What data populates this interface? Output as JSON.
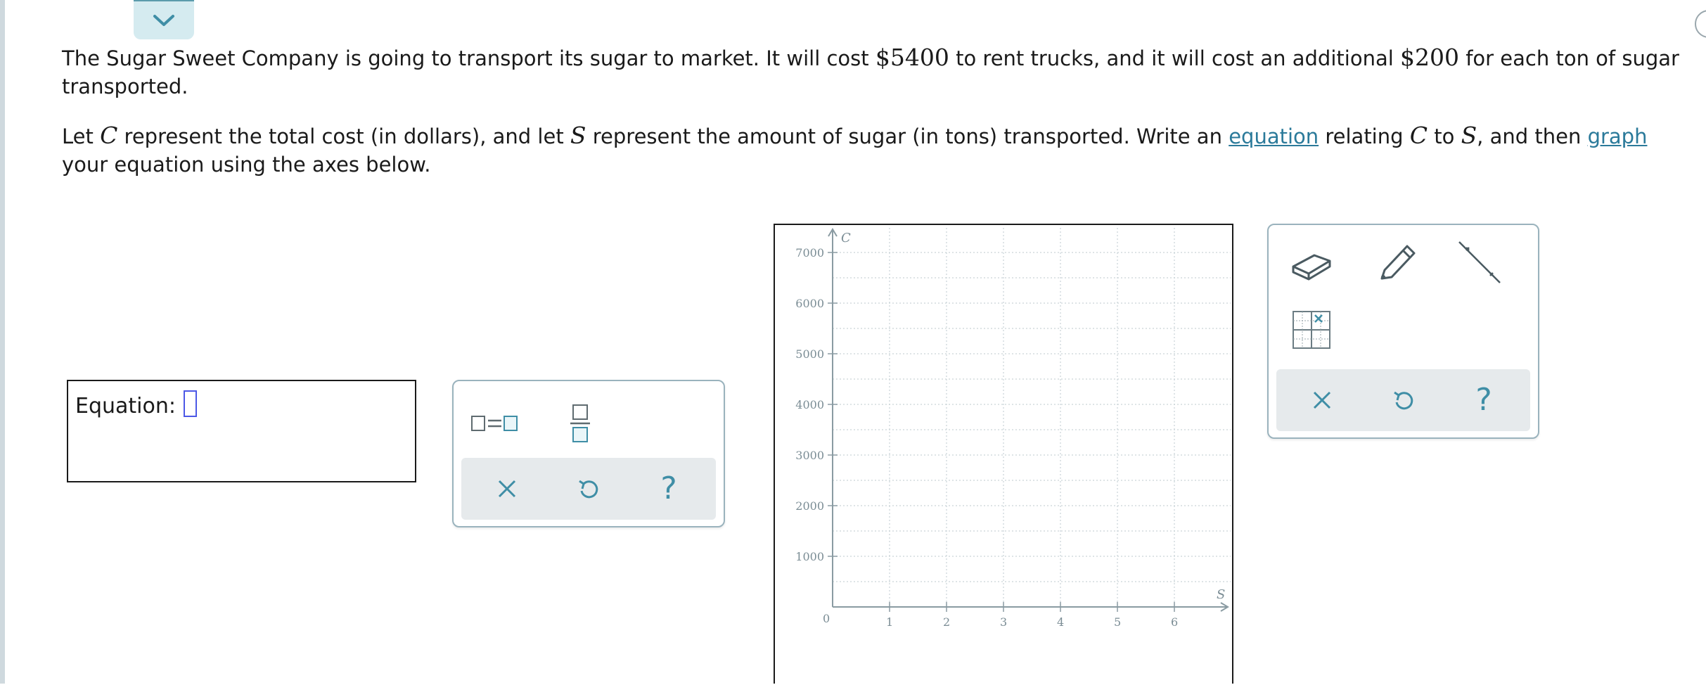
{
  "question": {
    "p1": {
      "a": "The Sugar Sweet Company is going to transport its sugar to market. It will cost ",
      "cost1": "$5400",
      "b": " to rent trucks, and it will cost an additional ",
      "cost2": "$200",
      "c": " for each ton of sugar transported."
    },
    "p2": {
      "a": "Let ",
      "var_c": "C",
      "b": " represent the total cost (in dollars), and let ",
      "var_s": "S",
      "c": " represent the amount of sugar (in tons) transported. Write an ",
      "link_equation": "equation",
      "d": " relating ",
      "var_c2": "C",
      "e": " to ",
      "var_s2": "S",
      "f": ", and then ",
      "link_graph": "graph",
      "g": " your equation using the axes below."
    }
  },
  "equation": {
    "label": "Equation:"
  },
  "equation_tools": {
    "equals_template_icon": "box-equals-box-icon",
    "fraction_icon": "fraction-icon",
    "help": "?"
  },
  "graph": {
    "x_axis_label": "S",
    "y_axis_label": "C",
    "origin_label": "0",
    "x_ticks": [
      "1",
      "2",
      "3",
      "4",
      "5",
      "6"
    ],
    "y_ticks": [
      "1000",
      "2000",
      "3000",
      "4000",
      "5000",
      "6000",
      "7000"
    ],
    "xlim": [
      0,
      7
    ],
    "ylim": [
      0,
      7500
    ],
    "grid": true
  },
  "graph_tools": {
    "eraser_icon": "eraser-icon",
    "pencil_icon": "pencil-icon",
    "line_icon": "line-tool-icon",
    "grid_icon": "graph-grid-icon",
    "help": "?"
  },
  "colors": {
    "accent": "#3f8ea6",
    "link": "#2b7a9a",
    "panel_border": "#9ab3bd",
    "action_bar": "#e6eaec",
    "input_slot": "#4c58e6"
  }
}
